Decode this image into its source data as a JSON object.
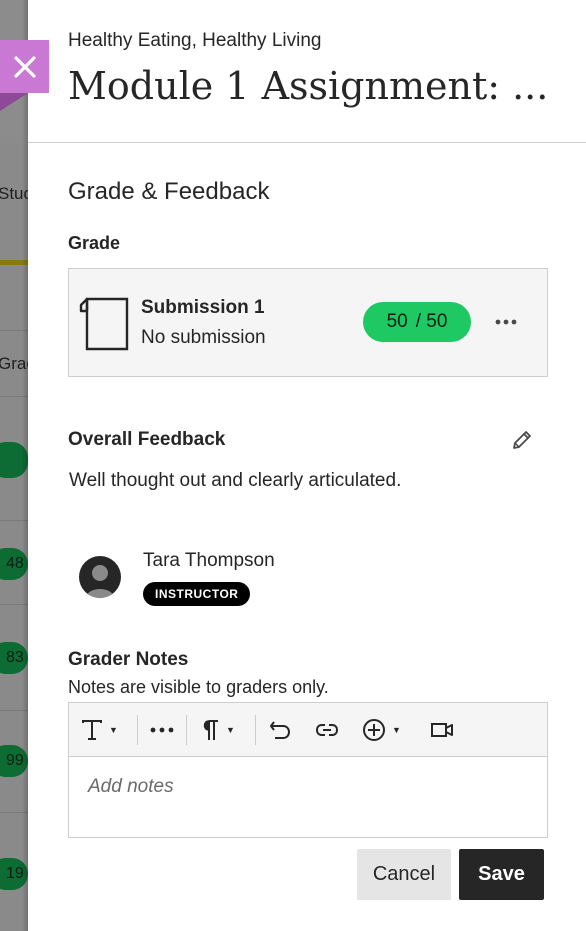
{
  "background": {
    "partial_texts": [
      "Stud",
      "Grad"
    ],
    "partial_values": [
      "48",
      "83",
      "99",
      "19"
    ]
  },
  "close_button": {
    "label": "✕"
  },
  "header": {
    "course_name": "Healthy Eating, Healthy Living",
    "assignment_title": "Module 1 Assignment: ..."
  },
  "grade_feedback": {
    "section_title": "Grade & Feedback",
    "grade_label": "Grade",
    "submission": {
      "title": "Submission 1",
      "status": "No submission",
      "score": "50",
      "max_score": "/ 50"
    }
  },
  "overall_feedback": {
    "title": "Overall Feedback",
    "text": "Well thought out and clearly articulated."
  },
  "instructor": {
    "name": "Tara Thompson",
    "role": "INSTRUCTOR"
  },
  "grader_notes": {
    "title": "Grader Notes",
    "help_text": "Notes are visible to graders only.",
    "placeholder": "Add notes"
  },
  "toolbar": {
    "icons": [
      "text-format-icon",
      "more-options-icon",
      "paragraph-icon",
      "undo-icon",
      "link-icon",
      "insert-content-icon",
      "video-icon"
    ]
  },
  "actions": {
    "cancel_label": "Cancel",
    "save_label": "Save"
  },
  "colors": {
    "accent_close": "#c978d3",
    "grade_pill": "#1ec863",
    "save_button": "#262626"
  }
}
